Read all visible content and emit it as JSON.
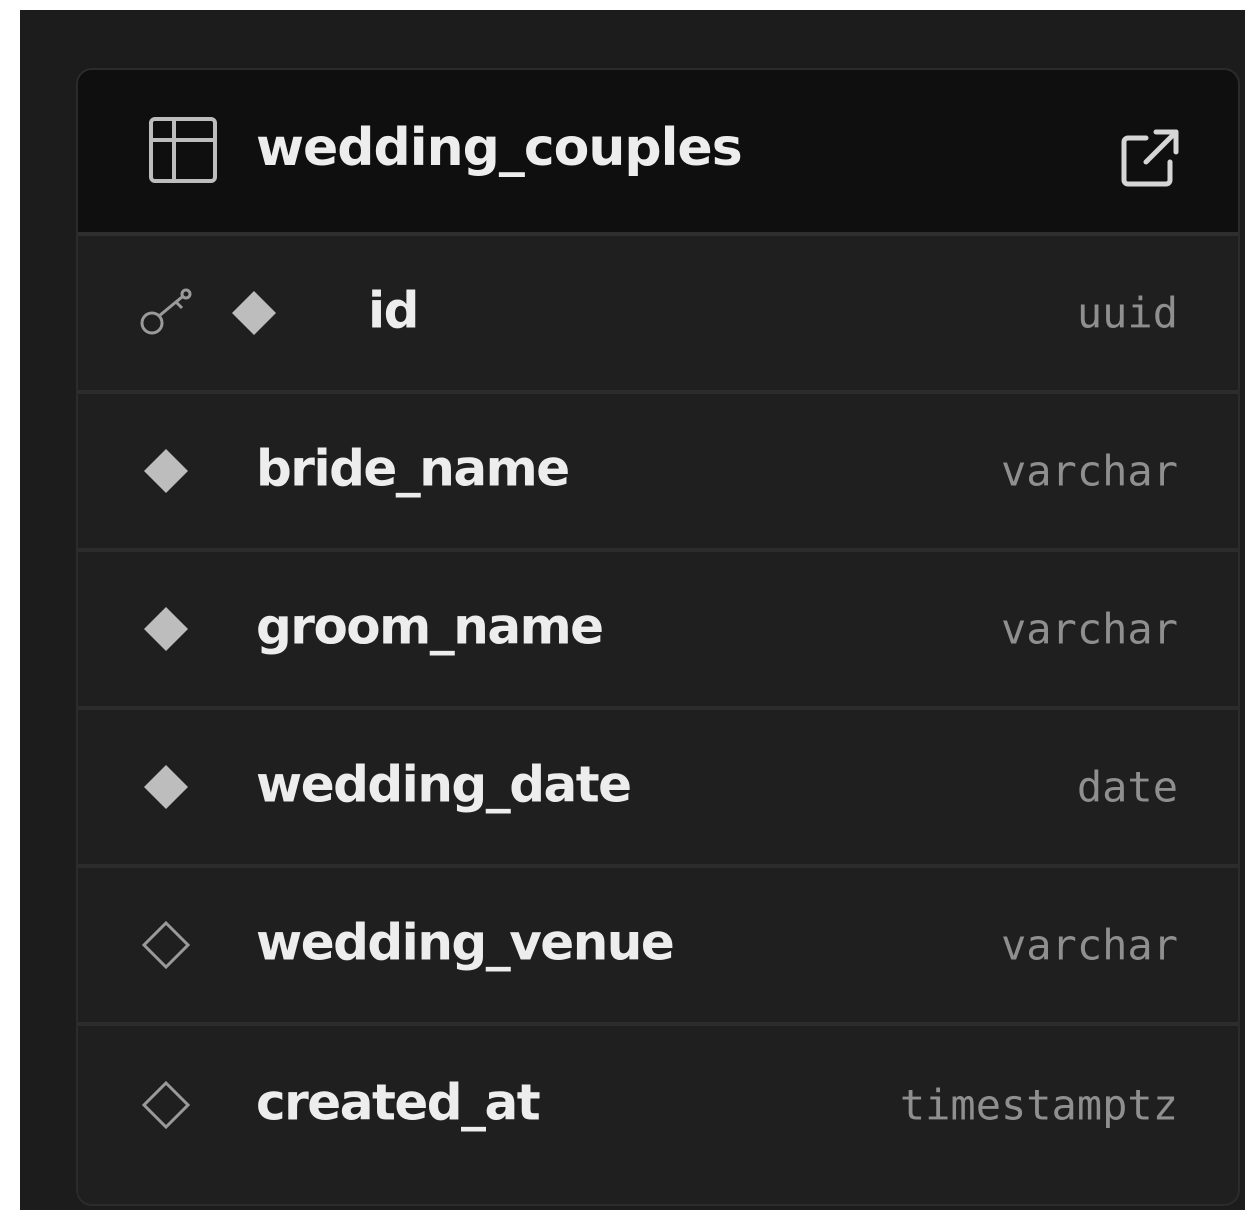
{
  "table": {
    "name": "wedding_couples",
    "columns": [
      {
        "name": "id",
        "type": "uuid",
        "primary_key": true,
        "nullable": false
      },
      {
        "name": "bride_name",
        "type": "varchar",
        "primary_key": false,
        "nullable": false
      },
      {
        "name": "groom_name",
        "type": "varchar",
        "primary_key": false,
        "nullable": false
      },
      {
        "name": "wedding_date",
        "type": "date",
        "primary_key": false,
        "nullable": false
      },
      {
        "name": "wedding_venue",
        "type": "varchar",
        "primary_key": false,
        "nullable": true
      },
      {
        "name": "created_at",
        "type": "timestamptz",
        "primary_key": false,
        "nullable": true
      }
    ]
  },
  "icons": {
    "table": "table-icon",
    "open": "external-link-icon",
    "primary_key": "key-icon",
    "required": "filled-diamond-icon",
    "nullable": "outline-diamond-icon"
  },
  "colors": {
    "background": "#1c1c1c",
    "card": "#1f1f1f",
    "header": "#0f0f0f",
    "text": "#ededed",
    "type_text": "#8f8f8f",
    "icon": "#bdbdbd"
  }
}
